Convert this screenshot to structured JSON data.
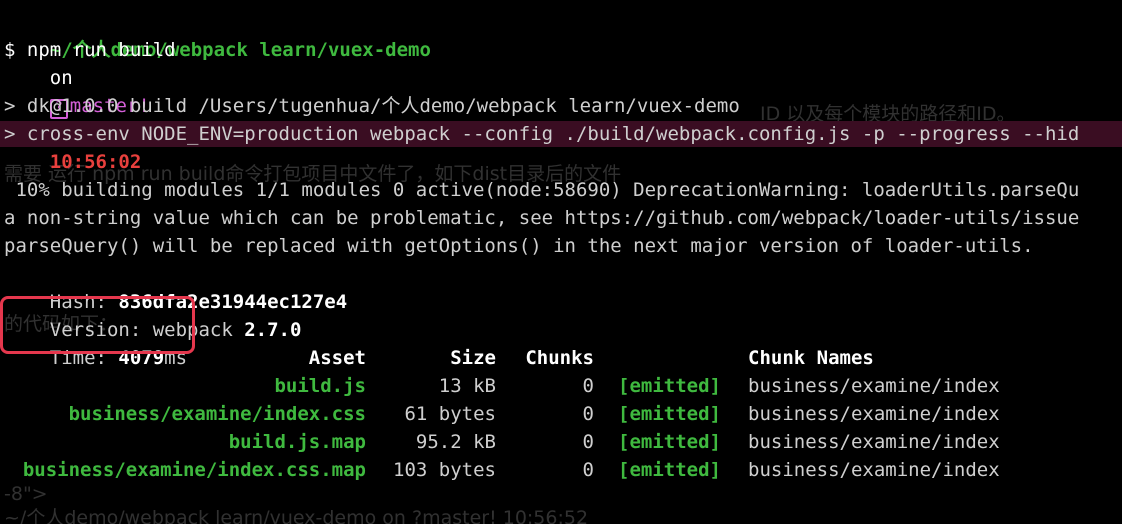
{
  "prompt1": {
    "path": "~/个人demo/webpack learn/vuex-demo",
    "on": "on",
    "branch_glyph": "?",
    "branch": "master!",
    "time": "10:56:02"
  },
  "command": "$ npm run build",
  "script_echo": [
    "> dk@1.0.0 build /Users/tugenhua/个人demo/webpack learn/vuex-demo",
    "> cross-env NODE_ENV=production webpack --config ./build/webpack.config.js -p --progress --hid"
  ],
  "progress_lines": [
    " 10% building modules 1/1 modules 0 active(node:58690) DeprecationWarning: loaderUtils.parseQu",
    "a non-string value which can be problematic, see https://github.com/webpack/loader-utils/issue",
    "parseQuery() will be replaced with getOptions() in the next major version of loader-utils."
  ],
  "hash": {
    "label": "Hash: ",
    "value": "836dfa2e31944ec127e4"
  },
  "version": {
    "label": "Version: webpack ",
    "value": "2.7.0"
  },
  "time_stat": {
    "label": "Time: ",
    "value": "4079",
    "unit": "ms"
  },
  "table": {
    "headers": {
      "asset": "Asset",
      "size": "Size",
      "chunks": "Chunks",
      "chunk_names": "Chunk Names"
    },
    "rows": [
      {
        "asset": "build.js",
        "size": "13 kB",
        "chunks": "0",
        "status": "[emitted]",
        "name": "business/examine/index"
      },
      {
        "asset": "business/examine/index.css",
        "size": "61 bytes",
        "chunks": "0",
        "status": "[emitted]",
        "name": "business/examine/index"
      },
      {
        "asset": "build.js.map",
        "size": "95.2 kB",
        "chunks": "0",
        "status": "[emitted]",
        "name": "business/examine/index"
      },
      {
        "asset": "business/examine/index.css.map",
        "size": "103 bytes",
        "chunks": "0",
        "status": "[emitted]",
        "name": "business/examine/index"
      }
    ]
  },
  "ghost_text": {
    "g1": "ID 以及每个模块的路径和ID。",
    "g2": "需要 运行 npm run build命令打包项目中文件了，如下dist目录后的文件",
    "g3": "的代码如下：",
    "g4": "-8\">",
    "g5": "~/个人demo/webpack learn/vuex-demo on ?master! 10:56:52"
  },
  "colors": {
    "green": "#3fb93f",
    "magenta": "#d45fd8",
    "red": "#e8403d",
    "highlight": "#3a0d22",
    "annotation_box": "#e5374d"
  }
}
